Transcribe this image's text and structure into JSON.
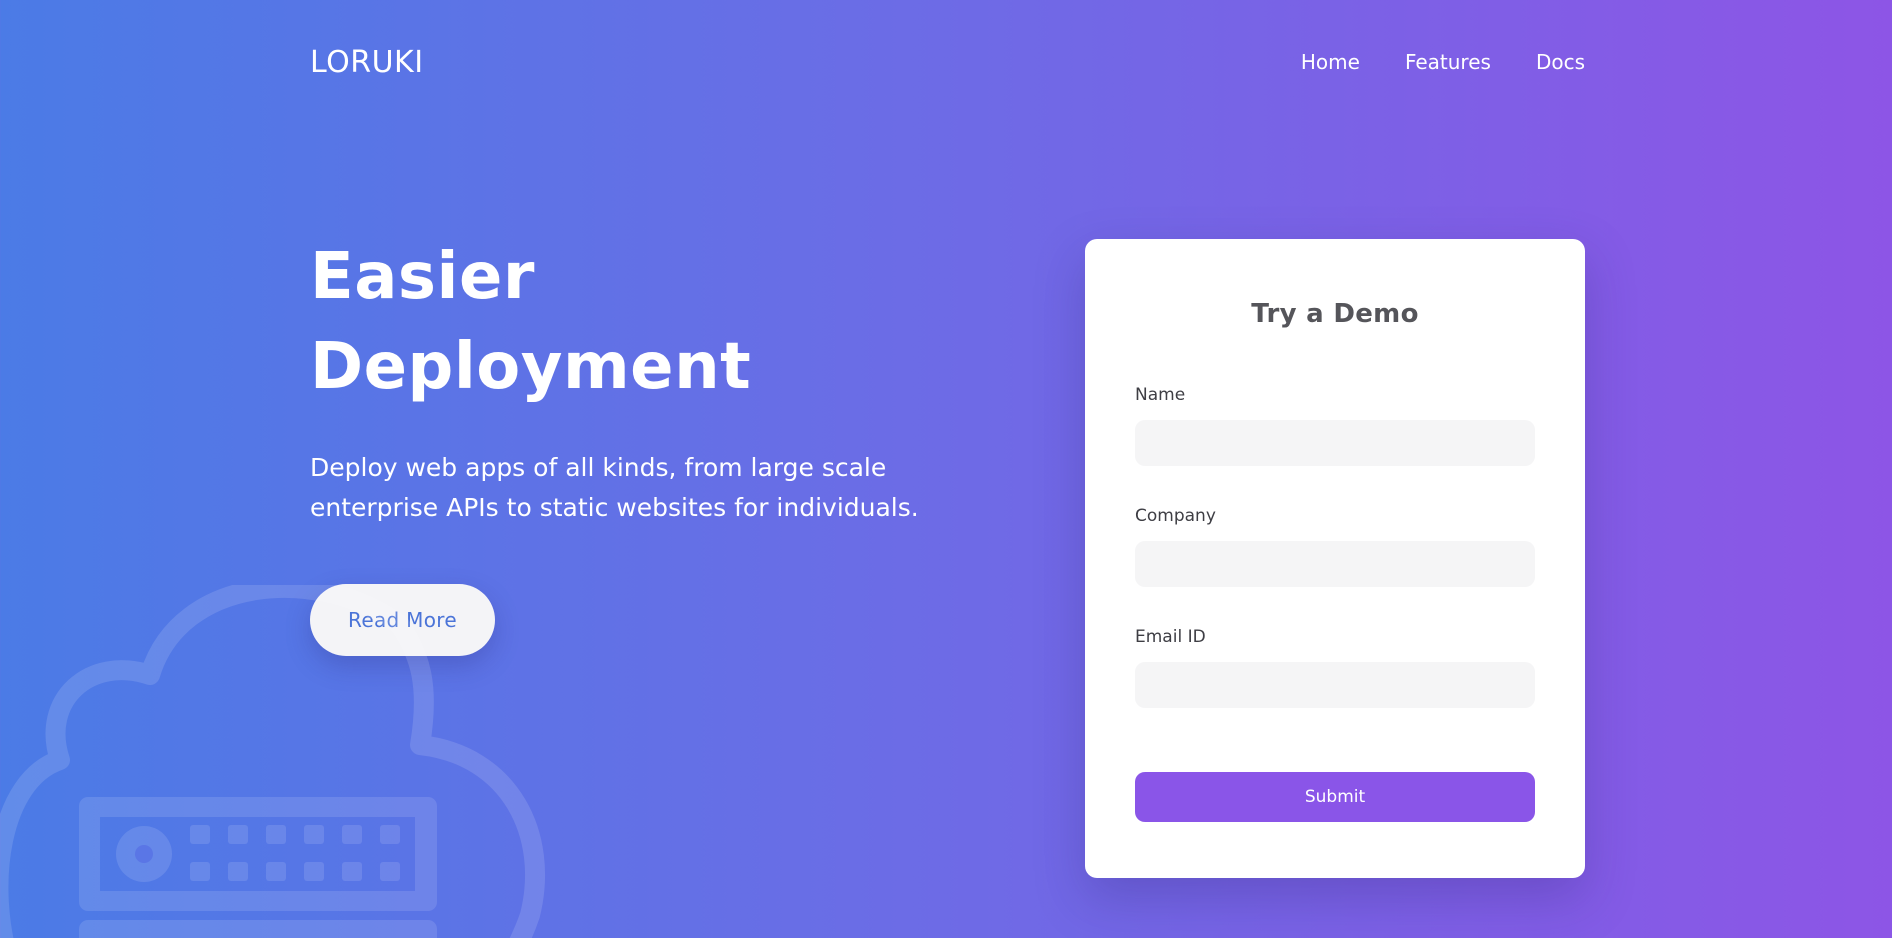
{
  "nav": {
    "brand": "LORUKI",
    "links": [
      "Home",
      "Features",
      "Docs"
    ]
  },
  "hero": {
    "title": "Easier Deployment",
    "description": "Deploy web apps of all kinds, from large scale enterprise APIs to static websites for individuals.",
    "read_more_label": "Read More"
  },
  "demo_form": {
    "title": "Try a Demo",
    "fields": [
      {
        "label": "Name",
        "value": "",
        "placeholder": ""
      },
      {
        "label": "Company",
        "value": "",
        "placeholder": ""
      },
      {
        "label": "Email ID",
        "value": "",
        "placeholder": ""
      }
    ],
    "submit_label": "Submit"
  },
  "decoration": {
    "icon": "cloud-server-icon"
  },
  "colors": {
    "gradient_start": "#4b7be6",
    "gradient_end": "#8d55e6",
    "accent": "#8a55e8",
    "read_more_text": "#4b74d8"
  }
}
